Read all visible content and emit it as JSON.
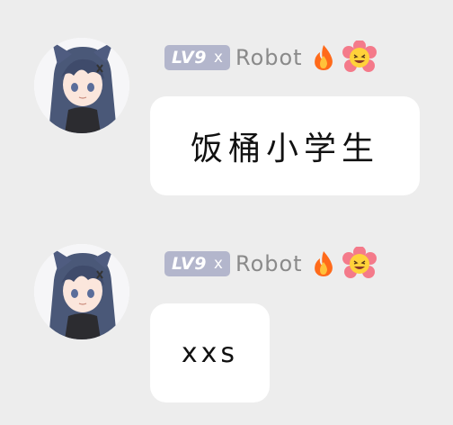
{
  "messages": [
    {
      "sender": "Robot",
      "level_badge": "LV9",
      "badge_x": "x",
      "status_icons": [
        "fire-icon",
        "laughing-flower-icon"
      ],
      "text": "饭桶小学生"
    },
    {
      "sender": "Robot",
      "level_badge": "LV9",
      "badge_x": "x",
      "status_icons": [
        "fire-icon",
        "laughing-flower-icon"
      ],
      "text": "xxs"
    }
  ],
  "colors": {
    "background": "#ededed",
    "bubble": "#ffffff",
    "badge": "#b3b6cc",
    "sender_text": "#8a8a8a",
    "avatar_hair": "#4a5878"
  }
}
